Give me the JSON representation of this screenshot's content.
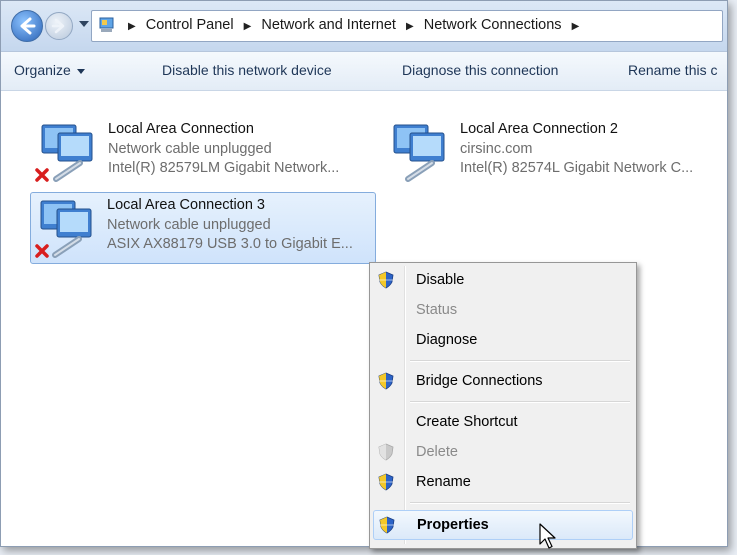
{
  "breadcrumb": [
    "Control Panel",
    "Network and Internet",
    "Network Connections"
  ],
  "toolbar": {
    "organize": "Organize",
    "disable": "Disable this network device",
    "diagnose": "Diagnose this connection",
    "rename": "Rename this c"
  },
  "connections": [
    {
      "name": "Local Area Connection",
      "status": "Network cable unplugged",
      "device": "Intel(R) 82579LM Gigabit Network...",
      "unplugged": true
    },
    {
      "name": "Local Area Connection 2",
      "status": "cirsinc.com",
      "device": "Intel(R) 82574L Gigabit Network C...",
      "unplugged": false
    },
    {
      "name": "Local Area Connection 3",
      "status": "Network cable unplugged",
      "device": "ASIX AX88179 USB 3.0 to Gigabit E...",
      "unplugged": true,
      "selected": true
    }
  ],
  "context_menu": {
    "items": [
      {
        "label": "Disable",
        "shield": true,
        "enabled": true
      },
      {
        "label": "Status",
        "shield": false,
        "enabled": false
      },
      {
        "label": "Diagnose",
        "shield": false,
        "enabled": true
      },
      {
        "label": "Bridge Connections",
        "shield": true,
        "enabled": true
      },
      {
        "label": "Create Shortcut",
        "shield": false,
        "enabled": true
      },
      {
        "label": "Delete",
        "shield": true,
        "enabled": false
      },
      {
        "label": "Rename",
        "shield": true,
        "enabled": true
      },
      {
        "label": "Properties",
        "shield": true,
        "enabled": true,
        "default": true,
        "highlighted": true
      }
    ]
  },
  "icons": {
    "back": "back-arrow-icon",
    "forward": "forward-arrow-icon",
    "control_panel": "control-panel-icon",
    "network_adapter": "network-adapter-icon",
    "unplugged": "red-x-icon",
    "uac_shield": "uac-shield-icon",
    "cursor": "mouse-pointer-icon"
  },
  "colors": {
    "selection": "#cfe3fb",
    "menu_bg": "#f0f0f0",
    "link_text": "#1e3657"
  }
}
